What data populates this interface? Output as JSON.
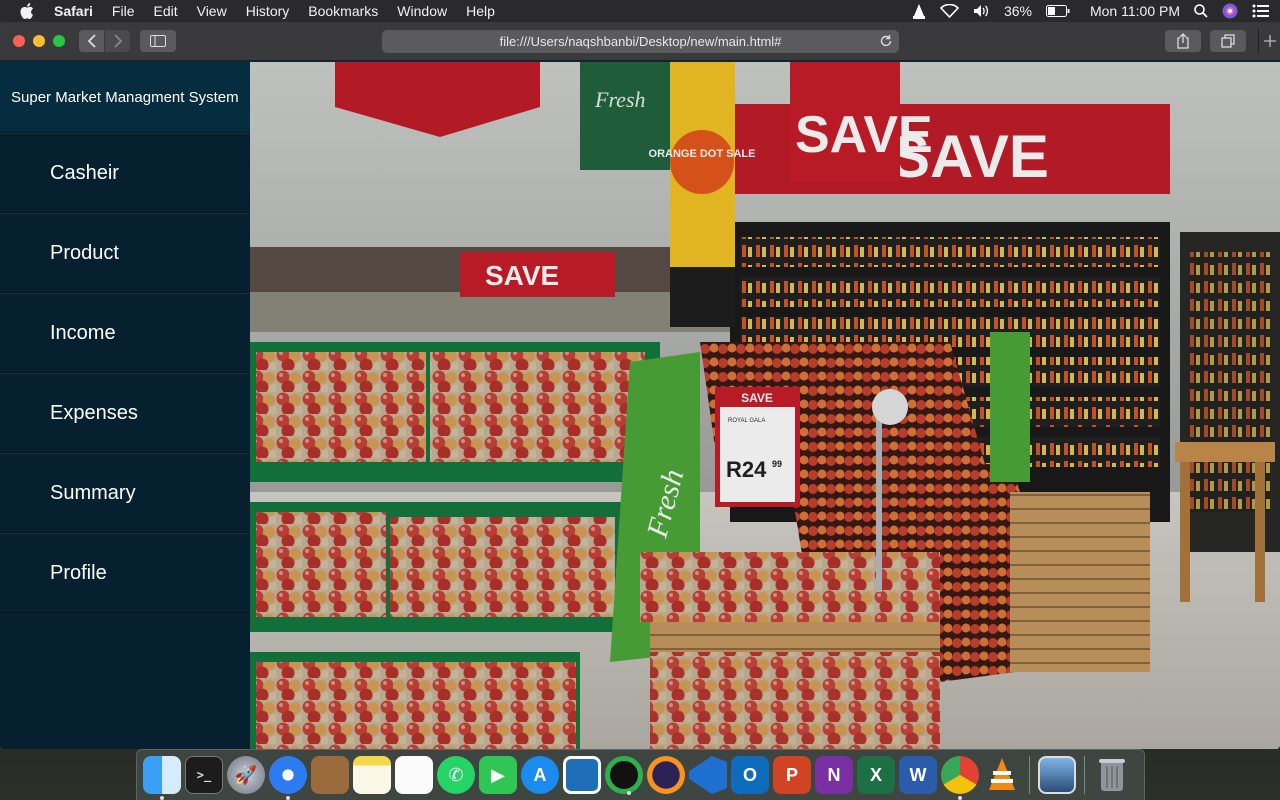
{
  "menubar": {
    "app_name": "Safari",
    "menus": [
      "File",
      "Edit",
      "View",
      "History",
      "Bookmarks",
      "Window",
      "Help"
    ],
    "battery": "36%",
    "clock": "Mon 11:00 PM"
  },
  "browser": {
    "url": "file:///Users/naqshbanbi/Desktop/new/main.html#"
  },
  "app": {
    "brand": "Super Market Managment System",
    "nav": [
      "Casheir",
      "Product",
      "Income",
      "Expenses",
      "Summary",
      "Profile"
    ]
  },
  "hero": {
    "sign_save_1": "SAVE",
    "sign_save_2": "SAVE",
    "sign_save_3": "SAVE",
    "sign_orange": "ORANGE DOT SALE",
    "price_header": "SAVE",
    "price_product": "ROYAL GALA",
    "price": "R24",
    "price_cents": "99",
    "brand_sign": "Fresh"
  },
  "dock": {
    "apps": [
      "finder",
      "terminal",
      "launchpad",
      "safari",
      "notefile",
      "notes",
      "reminders",
      "whatsapp",
      "facetime",
      "app-store",
      "screen-capture",
      "activity",
      "eclipse",
      "vscode",
      "outlook",
      "powerpoint",
      "onenote",
      "excel",
      "word",
      "chrome",
      "vlc",
      "preview",
      "trash"
    ]
  }
}
